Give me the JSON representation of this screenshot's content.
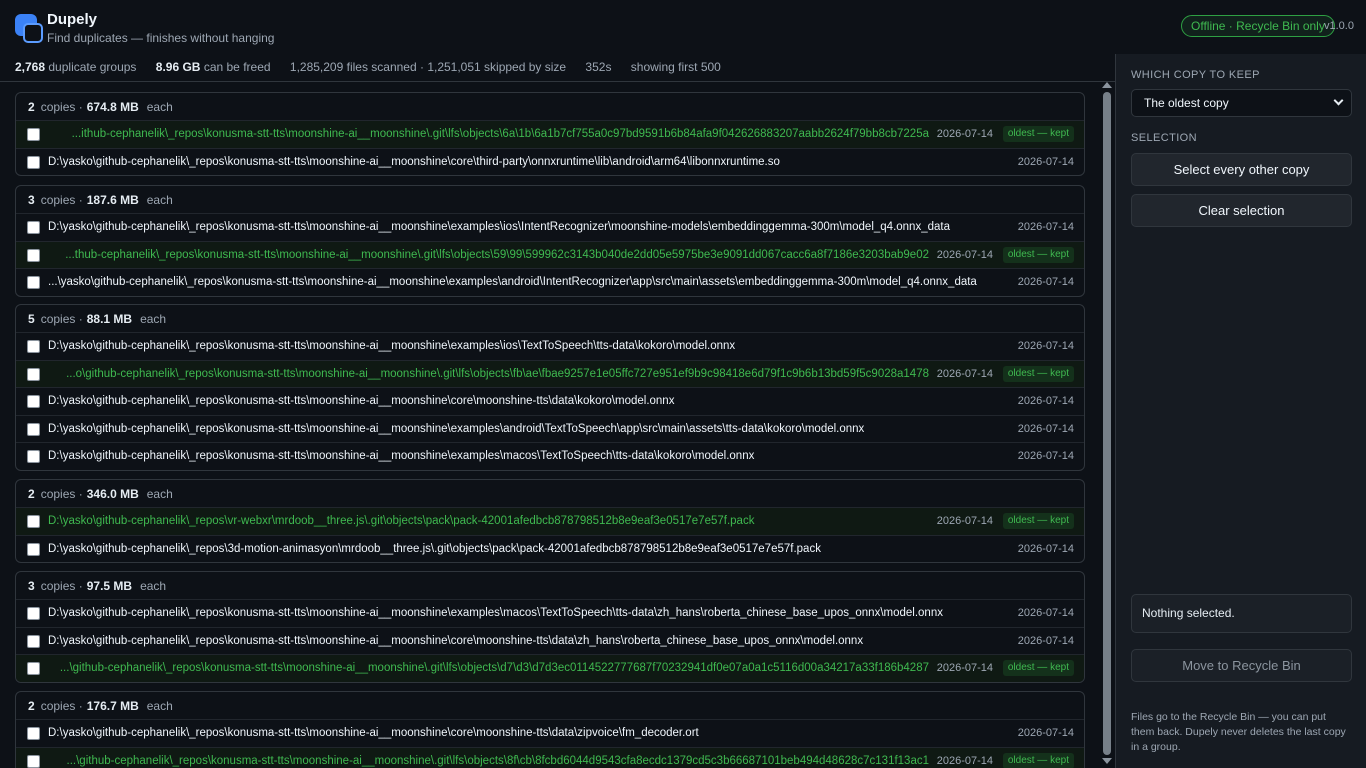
{
  "app": {
    "title": "Dupely",
    "subtitle": "Find duplicates — finishes without hanging",
    "status_badge": "Offline · Recycle Bin only",
    "version": "v1.0.0"
  },
  "stats": {
    "groups_count": "2,768",
    "groups_label": "duplicate groups",
    "freeable": "8.96 GB",
    "freeable_label": "can be freed",
    "scanned": "1,285,209 files scanned · 1,251,051 skipped by size",
    "elapsed": "352s",
    "showing": "showing first 500"
  },
  "labels": {
    "copies": "copies ·",
    "each": "each",
    "kept_tag": "oldest — kept"
  },
  "groups": [
    {
      "count": "2",
      "size": "674.8 MB",
      "files": [
        {
          "path": "...ithub-cephanelik\\_repos\\konusma-stt-tts\\moonshine-ai__moonshine\\.git\\lfs\\objects\\6a\\1b\\6a1b7cf755a0c97bd9591b6b84afa9f042626883207aabb2624f79bb8cb7225a",
          "date": "2026-07-14",
          "kept": true
        },
        {
          "path": "D:\\yasko\\github-cephanelik\\_repos\\konusma-stt-tts\\moonshine-ai__moonshine\\core\\third-party\\onnxruntime\\lib\\android\\arm64\\libonnxruntime.so",
          "date": "2026-07-14",
          "kept": false
        }
      ]
    },
    {
      "count": "3",
      "size": "187.6 MB",
      "files": [
        {
          "path": "D:\\yasko\\github-cephanelik\\_repos\\konusma-stt-tts\\moonshine-ai__moonshine\\examples\\ios\\IntentRecognizer\\moonshine-models\\embeddinggemma-300m\\model_q4.onnx_data",
          "date": "2026-07-14",
          "kept": false
        },
        {
          "path": "...thub-cephanelik\\_repos\\konusma-stt-tts\\moonshine-ai__moonshine\\.git\\lfs\\objects\\59\\99\\599962c3143b040de2dd05e5975be3e9091dd067cacc6a8f7186e3203bab9e02",
          "date": "2026-07-14",
          "kept": true
        },
        {
          "path": "...\\yasko\\github-cephanelik\\_repos\\konusma-stt-tts\\moonshine-ai__moonshine\\examples\\android\\IntentRecognizer\\app\\src\\main\\assets\\embeddinggemma-300m\\model_q4.onnx_data",
          "date": "2026-07-14",
          "kept": false
        }
      ]
    },
    {
      "count": "5",
      "size": "88.1 MB",
      "files": [
        {
          "path": "D:\\yasko\\github-cephanelik\\_repos\\konusma-stt-tts\\moonshine-ai__moonshine\\examples\\ios\\TextToSpeech\\tts-data\\kokoro\\model.onnx",
          "date": "2026-07-14",
          "kept": false
        },
        {
          "path": "...o\\github-cephanelik\\_repos\\konusma-stt-tts\\moonshine-ai__moonshine\\.git\\lfs\\objects\\fb\\ae\\fbae9257e1e05ffc727e951ef9b9c98418e6d79f1c9b6b13bd59f5c9028a1478",
          "date": "2026-07-14",
          "kept": true
        },
        {
          "path": "D:\\yasko\\github-cephanelik\\_repos\\konusma-stt-tts\\moonshine-ai__moonshine\\core\\moonshine-tts\\data\\kokoro\\model.onnx",
          "date": "2026-07-14",
          "kept": false
        },
        {
          "path": "D:\\yasko\\github-cephanelik\\_repos\\konusma-stt-tts\\moonshine-ai__moonshine\\examples\\android\\TextToSpeech\\app\\src\\main\\assets\\tts-data\\kokoro\\model.onnx",
          "date": "2026-07-14",
          "kept": false
        },
        {
          "path": "D:\\yasko\\github-cephanelik\\_repos\\konusma-stt-tts\\moonshine-ai__moonshine\\examples\\macos\\TextToSpeech\\tts-data\\kokoro\\model.onnx",
          "date": "2026-07-14",
          "kept": false
        }
      ]
    },
    {
      "count": "2",
      "size": "346.0 MB",
      "files": [
        {
          "path": "D:\\yasko\\github-cephanelik\\_repos\\vr-webxr\\mrdoob__three.js\\.git\\objects\\pack\\pack-42001afedbcb878798512b8e9eaf3e0517e7e57f.pack",
          "date": "2026-07-14",
          "kept": true,
          "left": true
        },
        {
          "path": "D:\\yasko\\github-cephanelik\\_repos\\3d-motion-animasyon\\mrdoob__three.js\\.git\\objects\\pack\\pack-42001afedbcb878798512b8e9eaf3e0517e7e57f.pack",
          "date": "2026-07-14",
          "kept": false
        }
      ]
    },
    {
      "count": "3",
      "size": "97.5 MB",
      "files": [
        {
          "path": "D:\\yasko\\github-cephanelik\\_repos\\konusma-stt-tts\\moonshine-ai__moonshine\\examples\\macos\\TextToSpeech\\tts-data\\zh_hans\\roberta_chinese_base_upos_onnx\\model.onnx",
          "date": "2026-07-14",
          "kept": false
        },
        {
          "path": "D:\\yasko\\github-cephanelik\\_repos\\konusma-stt-tts\\moonshine-ai__moonshine\\core\\moonshine-tts\\data\\zh_hans\\roberta_chinese_base_upos_onnx\\model.onnx",
          "date": "2026-07-14",
          "kept": false
        },
        {
          "path": "...\\github-cephanelik\\_repos\\konusma-stt-tts\\moonshine-ai__moonshine\\.git\\lfs\\objects\\d7\\d3\\d7d3ec0114522777687f70232941df0e07a0a1c5116d00a34217a33f186b4287",
          "date": "2026-07-14",
          "kept": true
        }
      ]
    },
    {
      "count": "2",
      "size": "176.7 MB",
      "files": [
        {
          "path": "D:\\yasko\\github-cephanelik\\_repos\\konusma-stt-tts\\moonshine-ai__moonshine\\core\\moonshine-tts\\data\\zipvoice\\fm_decoder.ort",
          "date": "2026-07-14",
          "kept": false
        },
        {
          "path": "...\\github-cephanelik\\_repos\\konusma-stt-tts\\moonshine-ai__moonshine\\.git\\lfs\\objects\\8f\\cb\\8fcbd6044d9543cfa8ecdc1379cd5c3b66687101beb494d48628c7c131f13ac1",
          "date": "2026-07-14",
          "kept": true
        }
      ]
    }
  ],
  "sidebar": {
    "keep_label": "WHICH COPY TO KEEP",
    "keep_value": "The oldest copy",
    "selection_label": "SELECTION",
    "select_every_other": "Select every other copy",
    "clear_selection": "Clear selection",
    "status": "Nothing selected.",
    "move_button": "Move to Recycle Bin",
    "note": "Files go to the Recycle Bin — you can put them back. Dupely never deletes the last copy in a group."
  },
  "colors": {
    "background": "#0d1117",
    "panel": "#161b22",
    "accent": "#3b82f6",
    "kept_green": "#3fb950"
  }
}
